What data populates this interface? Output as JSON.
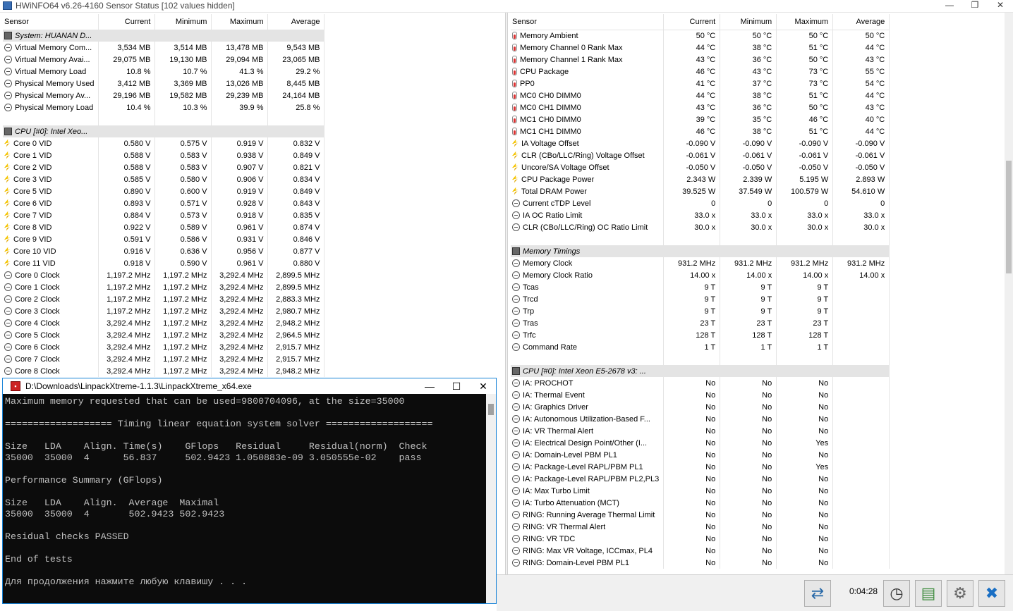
{
  "window": {
    "title": "HWiNFO64 v6.26-4160 Sensor Status [102 values hidden]"
  },
  "columns": {
    "sensor": "Sensor",
    "current": "Current",
    "minimum": "Minimum",
    "maximum": "Maximum",
    "average": "Average"
  },
  "left_rows": [
    {
      "type": "group",
      "label": "System: HUANAN D..."
    },
    {
      "icon": "circle",
      "label": "Virtual Memory Com...",
      "cur": "3,534 MB",
      "min": "3,514 MB",
      "max": "13,478 MB",
      "avg": "9,543 MB"
    },
    {
      "icon": "circle",
      "label": "Virtual Memory Avai...",
      "cur": "29,075 MB",
      "min": "19,130 MB",
      "max": "29,094 MB",
      "avg": "23,065 MB"
    },
    {
      "icon": "circle",
      "label": "Virtual Memory Load",
      "cur": "10.8 %",
      "min": "10.7 %",
      "max": "41.3 %",
      "avg": "29.2 %"
    },
    {
      "icon": "circle",
      "label": "Physical Memory Used",
      "cur": "3,412 MB",
      "min": "3,369 MB",
      "max": "13,026 MB",
      "avg": "8,445 MB"
    },
    {
      "icon": "circle",
      "label": "Physical Memory Av...",
      "cur": "29,196 MB",
      "min": "19,582 MB",
      "max": "29,239 MB",
      "avg": "24,164 MB"
    },
    {
      "icon": "circle",
      "label": "Physical Memory Load",
      "cur": "10.4 %",
      "min": "10.3 %",
      "max": "39.9 %",
      "avg": "25.8 %"
    },
    {
      "type": "blank"
    },
    {
      "type": "group",
      "label": "CPU [#0]: Intel Xeo..."
    },
    {
      "icon": "bolt",
      "label": "Core 0 VID",
      "cur": "0.580 V",
      "min": "0.575 V",
      "max": "0.919 V",
      "avg": "0.832 V"
    },
    {
      "icon": "bolt",
      "label": "Core 1 VID",
      "cur": "0.588 V",
      "min": "0.583 V",
      "max": "0.938 V",
      "avg": "0.849 V"
    },
    {
      "icon": "bolt",
      "label": "Core 2 VID",
      "cur": "0.588 V",
      "min": "0.583 V",
      "max": "0.907 V",
      "avg": "0.821 V"
    },
    {
      "icon": "bolt",
      "label": "Core 3 VID",
      "cur": "0.585 V",
      "min": "0.580 V",
      "max": "0.906 V",
      "avg": "0.834 V"
    },
    {
      "icon": "bolt",
      "label": "Core 5 VID",
      "cur": "0.890 V",
      "min": "0.600 V",
      "max": "0.919 V",
      "avg": "0.849 V"
    },
    {
      "icon": "bolt",
      "label": "Core 6 VID",
      "cur": "0.893 V",
      "min": "0.571 V",
      "max": "0.928 V",
      "avg": "0.843 V"
    },
    {
      "icon": "bolt",
      "label": "Core 7 VID",
      "cur": "0.884 V",
      "min": "0.573 V",
      "max": "0.918 V",
      "avg": "0.835 V"
    },
    {
      "icon": "bolt",
      "label": "Core 8 VID",
      "cur": "0.922 V",
      "min": "0.589 V",
      "max": "0.961 V",
      "avg": "0.874 V"
    },
    {
      "icon": "bolt",
      "label": "Core 9 VID",
      "cur": "0.591 V",
      "min": "0.586 V",
      "max": "0.931 V",
      "avg": "0.846 V"
    },
    {
      "icon": "bolt",
      "label": "Core 10 VID",
      "cur": "0.916 V",
      "min": "0.636 V",
      "max": "0.956 V",
      "avg": "0.877 V"
    },
    {
      "icon": "bolt",
      "label": "Core 11 VID",
      "cur": "0.918 V",
      "min": "0.590 V",
      "max": "0.961 V",
      "avg": "0.880 V"
    },
    {
      "icon": "circle",
      "label": "Core 0 Clock",
      "cur": "1,197.2 MHz",
      "min": "1,197.2 MHz",
      "max": "3,292.4 MHz",
      "avg": "2,899.5 MHz"
    },
    {
      "icon": "circle",
      "label": "Core 1 Clock",
      "cur": "1,197.2 MHz",
      "min": "1,197.2 MHz",
      "max": "3,292.4 MHz",
      "avg": "2,899.5 MHz"
    },
    {
      "icon": "circle",
      "label": "Core 2 Clock",
      "cur": "1,197.2 MHz",
      "min": "1,197.2 MHz",
      "max": "3,292.4 MHz",
      "avg": "2,883.3 MHz"
    },
    {
      "icon": "circle",
      "label": "Core 3 Clock",
      "cur": "1,197.2 MHz",
      "min": "1,197.2 MHz",
      "max": "3,292.4 MHz",
      "avg": "2,980.7 MHz"
    },
    {
      "icon": "circle",
      "label": "Core 4 Clock",
      "cur": "3,292.4 MHz",
      "min": "1,197.2 MHz",
      "max": "3,292.4 MHz",
      "avg": "2,948.2 MHz"
    },
    {
      "icon": "circle",
      "label": "Core 5 Clock",
      "cur": "3,292.4 MHz",
      "min": "1,197.2 MHz",
      "max": "3,292.4 MHz",
      "avg": "2,964.5 MHz"
    },
    {
      "icon": "circle",
      "label": "Core 6 Clock",
      "cur": "3,292.4 MHz",
      "min": "1,197.2 MHz",
      "max": "3,292.4 MHz",
      "avg": "2,915.7 MHz"
    },
    {
      "icon": "circle",
      "label": "Core 7 Clock",
      "cur": "3,292.4 MHz",
      "min": "1,197.2 MHz",
      "max": "3,292.4 MHz",
      "avg": "2,915.7 MHz"
    },
    {
      "icon": "circle",
      "label": "Core 8 Clock",
      "cur": "3,292.4 MHz",
      "min": "1,197.2 MHz",
      "max": "3,292.4 MHz",
      "avg": "2,948.2 MHz"
    }
  ],
  "right_rows": [
    {
      "icon": "therm",
      "label": "Memory Ambient",
      "cur": "50 °C",
      "min": "50 °C",
      "max": "50 °C",
      "avg": "50 °C"
    },
    {
      "icon": "therm",
      "label": "Memory Channel 0 Rank Max",
      "cur": "44 °C",
      "min": "38 °C",
      "max": "51 °C",
      "avg": "44 °C"
    },
    {
      "icon": "therm",
      "label": "Memory Channel 1 Rank Max",
      "cur": "43 °C",
      "min": "36 °C",
      "max": "50 °C",
      "avg": "43 °C"
    },
    {
      "icon": "therm",
      "label": "CPU Package",
      "cur": "46 °C",
      "min": "43 °C",
      "max": "73 °C",
      "avg": "55 °C"
    },
    {
      "icon": "therm",
      "label": "PP0",
      "cur": "41 °C",
      "min": "37 °C",
      "max": "73 °C",
      "avg": "54 °C"
    },
    {
      "icon": "therm",
      "label": "MC0 CH0 DIMM0",
      "cur": "44 °C",
      "min": "38 °C",
      "max": "51 °C",
      "avg": "44 °C"
    },
    {
      "icon": "therm",
      "label": "MC0 CH1 DIMM0",
      "cur": "43 °C",
      "min": "36 °C",
      "max": "50 °C",
      "avg": "43 °C"
    },
    {
      "icon": "therm",
      "label": "MC1 CH0 DIMM0",
      "cur": "39 °C",
      "min": "35 °C",
      "max": "46 °C",
      "avg": "40 °C"
    },
    {
      "icon": "therm",
      "label": "MC1 CH1 DIMM0",
      "cur": "46 °C",
      "min": "38 °C",
      "max": "51 °C",
      "avg": "44 °C"
    },
    {
      "icon": "bolt",
      "label": "IA Voltage Offset",
      "cur": "-0.090 V",
      "min": "-0.090 V",
      "max": "-0.090 V",
      "avg": "-0.090 V"
    },
    {
      "icon": "bolt",
      "label": "CLR (CBo/LLC/Ring) Voltage Offset",
      "cur": "-0.061 V",
      "min": "-0.061 V",
      "max": "-0.061 V",
      "avg": "-0.061 V"
    },
    {
      "icon": "bolt",
      "label": "Uncore/SA Voltage Offset",
      "cur": "-0.050 V",
      "min": "-0.050 V",
      "max": "-0.050 V",
      "avg": "-0.050 V"
    },
    {
      "icon": "bolt",
      "label": "CPU Package Power",
      "cur": "2.343 W",
      "min": "2.339 W",
      "max": "5.195 W",
      "avg": "2.893 W"
    },
    {
      "icon": "bolt",
      "label": "Total DRAM Power",
      "cur": "39.525 W",
      "min": "37.549 W",
      "max": "100.579 W",
      "avg": "54.610 W"
    },
    {
      "icon": "circle",
      "label": "Current cTDP Level",
      "cur": "0",
      "min": "0",
      "max": "0",
      "avg": "0"
    },
    {
      "icon": "circle",
      "label": "IA OC Ratio Limit",
      "cur": "33.0 x",
      "min": "33.0 x",
      "max": "33.0 x",
      "avg": "33.0 x"
    },
    {
      "icon": "circle",
      "label": "CLR (CBo/LLC/Ring) OC Ratio Limit",
      "cur": "30.0 x",
      "min": "30.0 x",
      "max": "30.0 x",
      "avg": "30.0 x"
    },
    {
      "type": "blank"
    },
    {
      "type": "group",
      "label": "Memory Timings"
    },
    {
      "icon": "circle",
      "label": "Memory Clock",
      "cur": "931.2 MHz",
      "min": "931.2 MHz",
      "max": "931.2 MHz",
      "avg": "931.2 MHz"
    },
    {
      "icon": "circle",
      "label": "Memory Clock Ratio",
      "cur": "14.00 x",
      "min": "14.00 x",
      "max": "14.00 x",
      "avg": "14.00 x"
    },
    {
      "icon": "circle",
      "label": "Tcas",
      "cur": "9 T",
      "min": "9 T",
      "max": "9 T",
      "avg": ""
    },
    {
      "icon": "circle",
      "label": "Trcd",
      "cur": "9 T",
      "min": "9 T",
      "max": "9 T",
      "avg": ""
    },
    {
      "icon": "circle",
      "label": "Trp",
      "cur": "9 T",
      "min": "9 T",
      "max": "9 T",
      "avg": ""
    },
    {
      "icon": "circle",
      "label": "Tras",
      "cur": "23 T",
      "min": "23 T",
      "max": "23 T",
      "avg": ""
    },
    {
      "icon": "circle",
      "label": "Trfc",
      "cur": "128 T",
      "min": "128 T",
      "max": "128 T",
      "avg": ""
    },
    {
      "icon": "circle",
      "label": "Command Rate",
      "cur": "1 T",
      "min": "1 T",
      "max": "1 T",
      "avg": ""
    },
    {
      "type": "blank"
    },
    {
      "type": "group",
      "label": "CPU [#0]: Intel Xeon E5-2678 v3: ..."
    },
    {
      "icon": "circle",
      "label": "IA: PROCHOT",
      "cur": "No",
      "min": "No",
      "max": "No",
      "avg": ""
    },
    {
      "icon": "circle",
      "label": "IA: Thermal Event",
      "cur": "No",
      "min": "No",
      "max": "No",
      "avg": ""
    },
    {
      "icon": "circle",
      "label": "IA: Graphics Driver",
      "cur": "No",
      "min": "No",
      "max": "No",
      "avg": ""
    },
    {
      "icon": "circle",
      "label": "IA: Autonomous Utilization-Based F...",
      "cur": "No",
      "min": "No",
      "max": "No",
      "avg": ""
    },
    {
      "icon": "circle",
      "label": "IA: VR Thermal Alert",
      "cur": "No",
      "min": "No",
      "max": "No",
      "avg": ""
    },
    {
      "icon": "circle",
      "label": "IA: Electrical Design Point/Other (I...",
      "cur": "No",
      "min": "No",
      "max": "Yes",
      "avg": ""
    },
    {
      "icon": "circle",
      "label": "IA: Domain-Level PBM PL1",
      "cur": "No",
      "min": "No",
      "max": "No",
      "avg": ""
    },
    {
      "icon": "circle",
      "label": "IA: Package-Level RAPL/PBM PL1",
      "cur": "No",
      "min": "No",
      "max": "Yes",
      "avg": ""
    },
    {
      "icon": "circle",
      "label": "IA: Package-Level RAPL/PBM PL2,PL3",
      "cur": "No",
      "min": "No",
      "max": "No",
      "avg": ""
    },
    {
      "icon": "circle",
      "label": "IA: Max Turbo Limit",
      "cur": "No",
      "min": "No",
      "max": "No",
      "avg": ""
    },
    {
      "icon": "circle",
      "label": "IA: Turbo Attenuation (MCT)",
      "cur": "No",
      "min": "No",
      "max": "No",
      "avg": ""
    },
    {
      "icon": "circle",
      "label": "RING: Running Average Thermal Limit",
      "cur": "No",
      "min": "No",
      "max": "No",
      "avg": ""
    },
    {
      "icon": "circle",
      "label": "RING: VR Thermal Alert",
      "cur": "No",
      "min": "No",
      "max": "No",
      "avg": ""
    },
    {
      "icon": "circle",
      "label": "RING: VR TDC",
      "cur": "No",
      "min": "No",
      "max": "No",
      "avg": ""
    },
    {
      "icon": "circle",
      "label": "RING: Max VR Voltage, ICCmax, PL4",
      "cur": "No",
      "min": "No",
      "max": "No",
      "avg": ""
    },
    {
      "icon": "circle",
      "label": "RING: Domain-Level PBM PL1",
      "cur": "No",
      "min": "No",
      "max": "No",
      "avg": ""
    }
  ],
  "status": {
    "timer": "0:04:28"
  },
  "console": {
    "title": "D:\\Downloads\\LinpackXtreme-1.1.3\\LinpackXtreme_x64.exe",
    "lines": [
      "Maximum memory requested that can be used=9800704096, at the size=35000",
      "",
      "=================== Timing linear equation system solver ===================",
      "",
      "Size   LDA    Align. Time(s)    GFlops   Residual     Residual(norm)  Check",
      "35000  35000  4      56.837     502.9423 1.050883e-09 3.050555e-02    pass",
      "",
      "Performance Summary (GFlops)",
      "",
      "Size   LDA    Align.  Average  Maximal",
      "35000  35000  4       502.9423 502.9423",
      "",
      "Residual checks PASSED",
      "",
      "End of tests",
      "",
      "Для продолжения нажмите любую клавишу . . ."
    ]
  }
}
